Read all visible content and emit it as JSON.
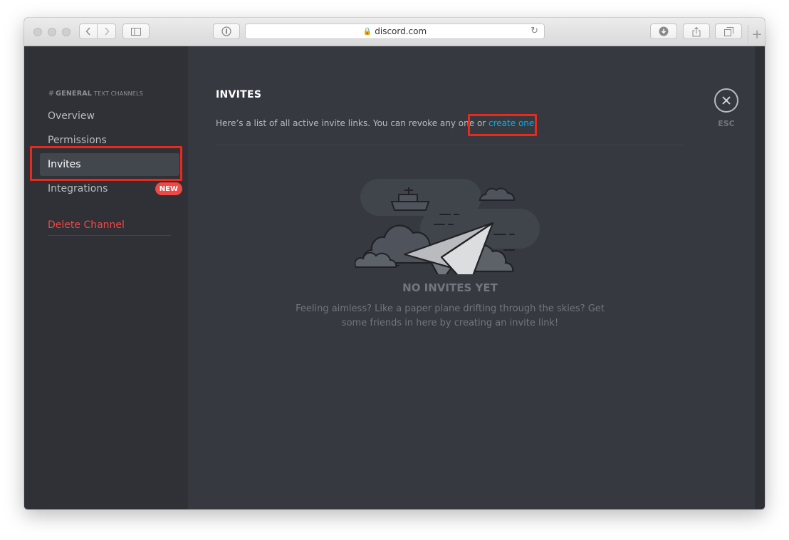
{
  "browser": {
    "url": "discord.com"
  },
  "sidebar": {
    "channel_name": "GENERAL",
    "channel_type": "TEXT CHANNELS",
    "items": [
      {
        "label": "Overview"
      },
      {
        "label": "Permissions"
      },
      {
        "label": "Invites"
      },
      {
        "label": "Integrations",
        "badge": "NEW"
      },
      {
        "label": "Delete Channel"
      }
    ]
  },
  "main": {
    "title": "INVITES",
    "description_prefix": "Here’s a list of all active invite links. You can revoke any one or ",
    "description_link": "create one",
    "description_suffix": ".",
    "empty_title": "NO INVITES YET",
    "empty_description": "Feeling aimless? Like a paper plane drifting through the skies? Get some friends in here by creating an invite link!",
    "close_label": "ESC"
  },
  "colors": {
    "accent_link": "#00b0f4",
    "danger": "#f04747",
    "highlight": "#e8291b"
  }
}
